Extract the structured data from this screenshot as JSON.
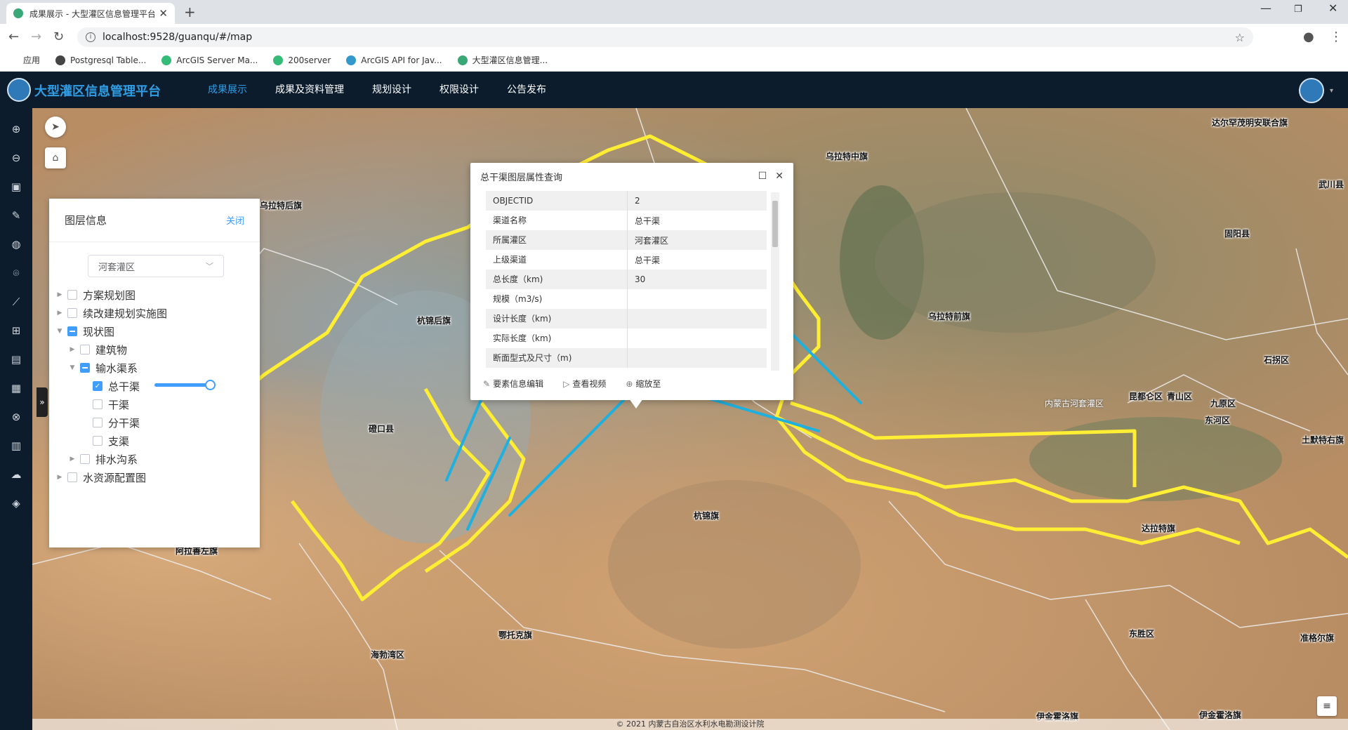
{
  "browser": {
    "tab_title": "成果展示 - 大型灌区信息管理平台",
    "url": "localhost:9528/guanqu/#/map",
    "bookmarks": [
      {
        "label": "应用",
        "color": "#e44"
      },
      {
        "label": "Postgresql Table...",
        "color": "#444"
      },
      {
        "label": "ArcGIS Server Ma...",
        "color": "#3b7"
      },
      {
        "label": "200server",
        "color": "#3b7"
      },
      {
        "label": "ArcGIS API for Jav...",
        "color": "#39c"
      },
      {
        "label": "大型灌区信息管理...",
        "color": "#3aa876"
      }
    ]
  },
  "app": {
    "title": "大型灌区信息管理平台",
    "accent": "#2f9de4",
    "menu": [
      "成果展示",
      "成果及资料管理",
      "规划设计",
      "权限设计",
      "公告发布"
    ]
  },
  "toolbar_icons": [
    "zoom-in-icon",
    "zoom-out-icon",
    "layer-icon",
    "edit-icon",
    "globe-icon",
    "pin-icon",
    "line-icon",
    "measure-icon",
    "ruler-icon",
    "bus-icon",
    "compass-icon",
    "chart-icon",
    "upload-icon",
    "tag-icon"
  ],
  "layer_panel": {
    "title": "图层信息",
    "close_label": "关闭",
    "selected_district": "河套灌区",
    "tree": {
      "n1": "方案规划图",
      "n2": "续改建规划实施图",
      "n3": "现状图",
      "n4": "建筑物",
      "n5": "输水渠系",
      "n6": "总干渠",
      "n7": "干渠",
      "n8": "分干渠",
      "n9": "支渠",
      "n10": "排水沟系",
      "n11": "水资源配置图"
    },
    "opacity_percent": 100
  },
  "popup": {
    "title": "总干渠图层属性查询",
    "rows": [
      {
        "key": "OBJECTID",
        "value": "2"
      },
      {
        "key": "渠道名称",
        "value": "总干渠"
      },
      {
        "key": "所属灌区",
        "value": "河套灌区"
      },
      {
        "key": "上级渠道",
        "value": "总干渠"
      },
      {
        "key": "总长度（km)",
        "value": "30"
      },
      {
        "key": "规模（m3/s)",
        "value": ""
      },
      {
        "key": "设计长度（km)",
        "value": ""
      },
      {
        "key": "实际长度（km)",
        "value": ""
      },
      {
        "key": "断面型式及尺寸（m)",
        "value": ""
      }
    ],
    "actions": {
      "edit": "要素信息编辑",
      "video": "查看视频",
      "zoom": "缩放至"
    }
  },
  "map_labels": {
    "l1": "乌拉特中旗",
    "l2": "达尔罕茂明安联合旗",
    "l3": "武川县",
    "l4": "固阳县",
    "l5": "杭锦后旗",
    "l6": "乌拉特前旗",
    "l7": "石拐区",
    "l8": "乌拉特后旗",
    "l9": "磴口县",
    "l10": "内蒙古河套灌区",
    "l11": "昆都仑区",
    "l12": "青山区",
    "l13": "九原区",
    "l14": "东河区",
    "l15": "土默特右旗",
    "l16": "杭锦旗",
    "l17": "达拉特旗",
    "l18": "阿拉善左旗",
    "l19": "鄂托克旗",
    "l20": "海勃湾区",
    "l21": "东胜区",
    "l22": "准格尔旗",
    "l23": "伊金霍洛旗",
    "l24": "伊金霍洛旗"
  },
  "copyright": "© 2021 内蒙古自治区水利水电勘测设计院",
  "colors": {
    "boundary": "#ffee33",
    "canal": "#1fb0de",
    "panel_accent": "#409eff"
  }
}
